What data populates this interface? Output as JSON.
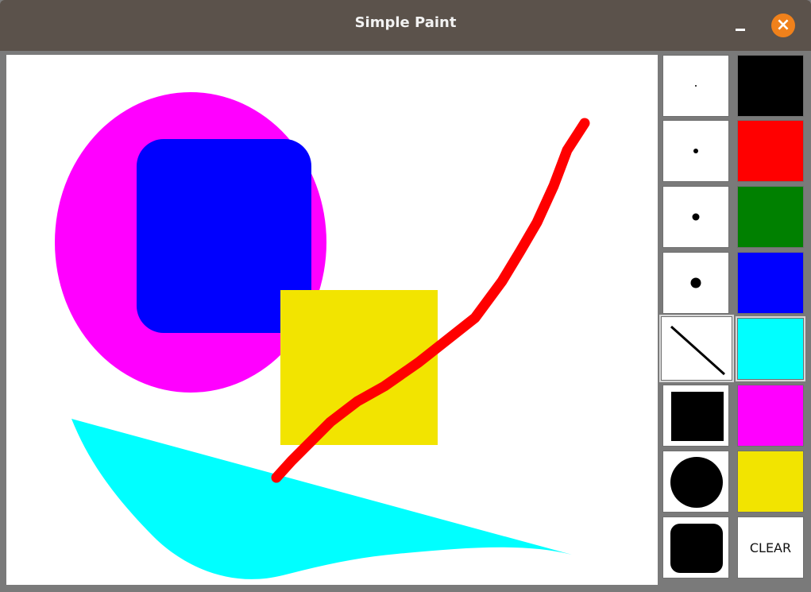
{
  "window": {
    "title": "Simple Paint",
    "close_symbol": "×",
    "colors": {
      "titlebar": "#5b524b",
      "close_button": "#f0811b",
      "window_border": "#7a7a7a"
    }
  },
  "toolbar": {
    "brushes": [
      {
        "name": "brush-size-1",
        "size": 1
      },
      {
        "name": "brush-size-2",
        "size": 2
      },
      {
        "name": "brush-size-3",
        "size": 3
      },
      {
        "name": "brush-size-4",
        "size": 4
      }
    ],
    "shapes": [
      {
        "name": "line-tool",
        "icon": "line-icon",
        "selected": true
      },
      {
        "name": "rectangle-tool",
        "icon": "filled-square-icon"
      },
      {
        "name": "ellipse-tool",
        "icon": "filled-circle-icon"
      },
      {
        "name": "rounded-rectangle-tool",
        "icon": "filled-rounded-square-icon"
      }
    ],
    "colors": [
      {
        "name": "black",
        "value": "#000000"
      },
      {
        "name": "red",
        "value": "#ff0000"
      },
      {
        "name": "green",
        "value": "#008000"
      },
      {
        "name": "blue",
        "value": "#0000ff"
      },
      {
        "name": "cyan",
        "value": "#00ffff",
        "selected": true
      },
      {
        "name": "magenta",
        "value": "#ff00ff"
      },
      {
        "name": "yellow",
        "value": "#f2e400"
      }
    ],
    "clear_label": "CLEAR"
  },
  "canvas": {
    "background": "#ffffff",
    "shapes": [
      {
        "type": "ellipse",
        "color": "#ff00ff"
      },
      {
        "type": "rounded-rectangle",
        "color": "#0000ff"
      },
      {
        "type": "rectangle",
        "color": "#f2e400"
      },
      {
        "type": "freehand-line",
        "color": "#ff0000"
      },
      {
        "type": "filled-polygon",
        "color": "#00ffff"
      }
    ]
  }
}
